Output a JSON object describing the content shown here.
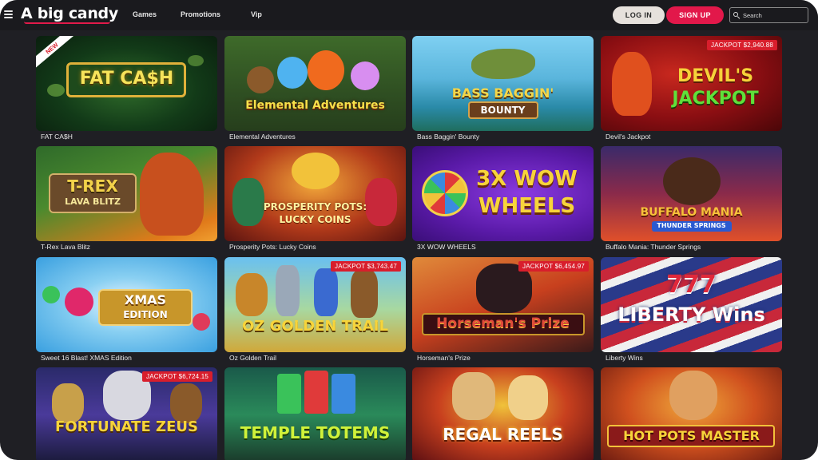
{
  "header": {
    "logo": "A big candy",
    "nav": [
      "Games",
      "Promotions",
      "Vip"
    ],
    "login_label": "LOG IN",
    "signup_label": "SIGN UP",
    "search_placeholder": "Search"
  },
  "colors": {
    "accent": "#e2184a",
    "jackpot": "#d81e2c",
    "background": "#1f1f24"
  },
  "games": [
    {
      "label": "FAT CA$H",
      "art": "FAT CA$H",
      "badge": "NEW",
      "jackpot": ""
    },
    {
      "label": "Elemental Adventures",
      "art": "Elemental Adventures",
      "badge": "",
      "jackpot": ""
    },
    {
      "label": "Bass Baggin' Bounty",
      "art": "BASS BAGGIN'",
      "art2": "BOUNTY",
      "badge": "",
      "jackpot": ""
    },
    {
      "label": "Devil's Jackpot",
      "art": "DEVIL'S",
      "art2": "JACKPOT",
      "badge": "",
      "jackpot": "JACKPOT $2,940.88"
    },
    {
      "label": "T-Rex Lava Blitz",
      "art": "T-REX",
      "art2": "LAVA BLITZ",
      "badge": "",
      "jackpot": ""
    },
    {
      "label": "Prosperity Pots: Lucky Coins",
      "art": "PROSPERITY POTS:",
      "art2": "LUCKY COINS",
      "badge": "",
      "jackpot": ""
    },
    {
      "label": "3X WOW WHEELS",
      "art": "3X WOW",
      "art2": "WHEELS",
      "badge": "",
      "jackpot": ""
    },
    {
      "label": "Buffalo Mania: Thunder Springs",
      "art": "BUFFALO MANIA",
      "art2": "THUNDER SPRINGS",
      "badge": "",
      "jackpot": ""
    },
    {
      "label": "Sweet 16 Blast! XMAS Edition",
      "art": "XMAS",
      "art2": "EDITION",
      "badge": "",
      "jackpot": ""
    },
    {
      "label": "Oz Golden Trail",
      "art": "OZ GOLDEN TRAIL",
      "badge": "",
      "jackpot": "JACKPOT $3,743.47"
    },
    {
      "label": "Horseman's Prize",
      "art": "Horseman's Prize",
      "badge": "",
      "jackpot": "JACKPOT $6,454.97"
    },
    {
      "label": "Liberty Wins",
      "art": "777",
      "art2": "LIBERTY Wins",
      "badge": "",
      "jackpot": ""
    },
    {
      "label": "",
      "art": "FORTUNATE ZEUS",
      "badge": "",
      "jackpot": "JACKPOT $6,724.15"
    },
    {
      "label": "",
      "art": "TEMPLE TOTEMS",
      "badge": "",
      "jackpot": ""
    },
    {
      "label": "",
      "art": "REGAL REELS",
      "badge": "",
      "jackpot": ""
    },
    {
      "label": "",
      "art": "HOT POTS MASTER",
      "badge": "",
      "jackpot": ""
    }
  ]
}
